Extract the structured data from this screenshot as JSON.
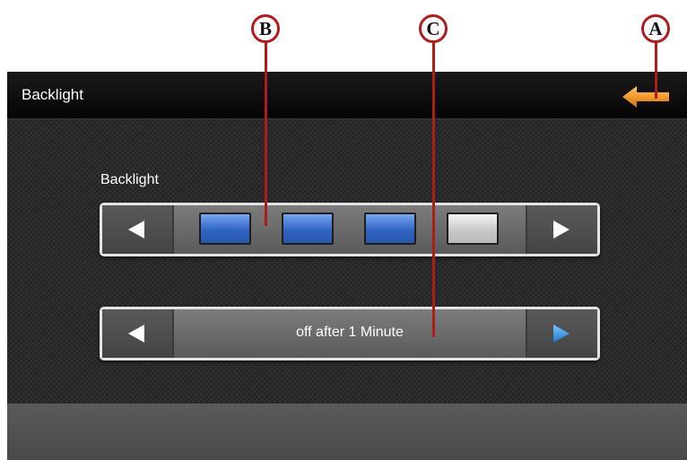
{
  "header": {
    "title": "Backlight",
    "back_icon": "back-arrow-icon"
  },
  "brightness": {
    "label": "Backlight",
    "level": 3,
    "max_level": 4,
    "decrease_icon": "left-arrow-icon",
    "increase_icon": "right-arrow-icon"
  },
  "timeout": {
    "value": "off after 1 Minute",
    "decrease_icon": "left-arrow-icon",
    "increase_icon": "right-arrow-icon"
  },
  "callouts": [
    "A",
    "B",
    "C"
  ],
  "colors": {
    "callout_red": "#b01c1c",
    "back_arrow_orange": "#f29a2e",
    "active_arrow_blue": "#2f8fe0",
    "bar_on_blue": "#2f64c2"
  }
}
